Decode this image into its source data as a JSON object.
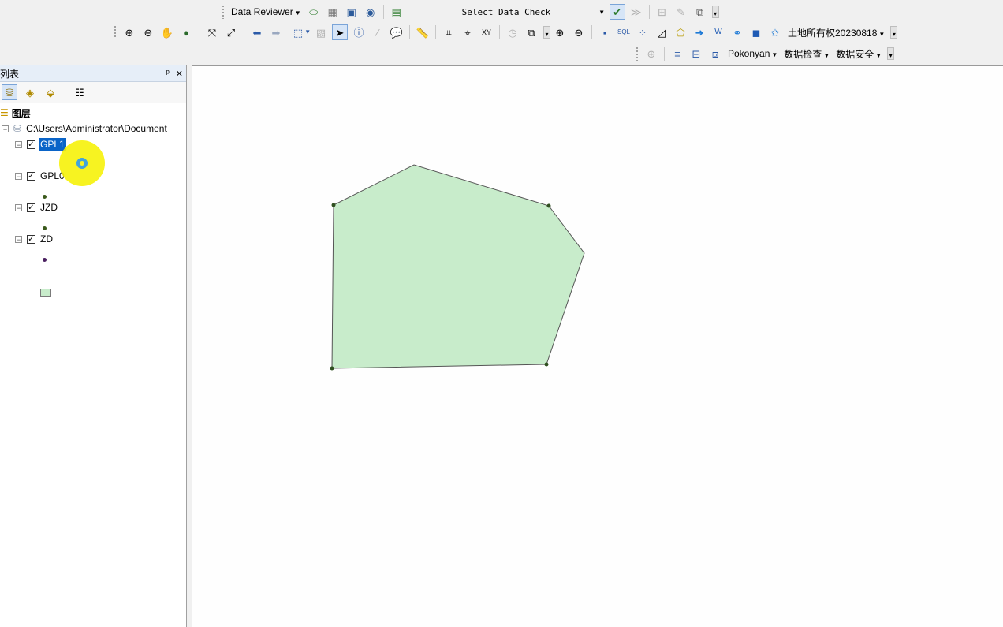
{
  "toolbar": {
    "row1": {
      "data_reviewer_label": "Data Reviewer",
      "select_check_label": "Select Data Check"
    },
    "row2": {
      "land_rights_label": "土地所有权20230818"
    },
    "row3": {
      "pokonyan_label": "Pokonyan",
      "data_check_label": "数据检查",
      "data_security_label": "数据安全"
    }
  },
  "toc": {
    "title": "列表",
    "pin_glyph": "ᵖ",
    "close_glyph": "✕",
    "root_label": "图层",
    "workspace_path": "C:\\Users\\Administrator\\Document",
    "layers": [
      {
        "name": "GPL1",
        "checked": true,
        "selected": true,
        "symbol": "point"
      },
      {
        "name": "GPL0",
        "checked": true,
        "selected": false,
        "symbol": "point"
      },
      {
        "name": "JZD",
        "checked": true,
        "selected": false,
        "symbol": "point"
      },
      {
        "name": "ZD",
        "checked": true,
        "selected": false,
        "symbol": "polygon"
      }
    ]
  },
  "map": {
    "polygon_fill": "#c8eccb",
    "polygon_stroke": "#555555",
    "vertex_color": "#2f4f1f"
  },
  "colors": {
    "selection": "#0a64c8",
    "cursor_highlight": "#f7f20a",
    "cursor_ring": "#2d9ad6"
  }
}
